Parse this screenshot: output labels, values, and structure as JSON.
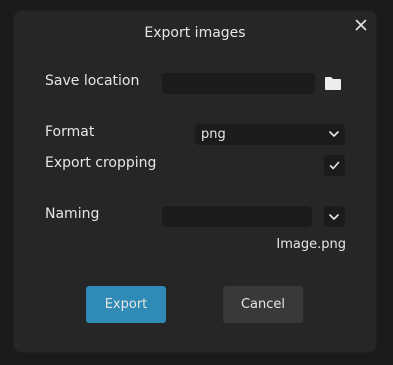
{
  "dialog": {
    "title": "Export images",
    "save_location": {
      "label": "Save location",
      "value": ""
    },
    "format": {
      "label": "Format",
      "selected": "png"
    },
    "export_cropping": {
      "label": "Export cropping",
      "checked": true
    },
    "naming": {
      "label": "Naming",
      "value": "",
      "preview": "Image.png"
    },
    "buttons": {
      "export": "Export",
      "cancel": "Cancel"
    }
  },
  "icons": {
    "close": "close-icon",
    "folder": "folder-icon",
    "chevron": "chevron-down-icon",
    "check": "checkmark-icon"
  },
  "colors": {
    "background": "#1b1b1b",
    "dialog": "#262626",
    "primary_button": "#2f8ab5",
    "secondary_button": "#393939",
    "text": "#e6e6e6"
  }
}
